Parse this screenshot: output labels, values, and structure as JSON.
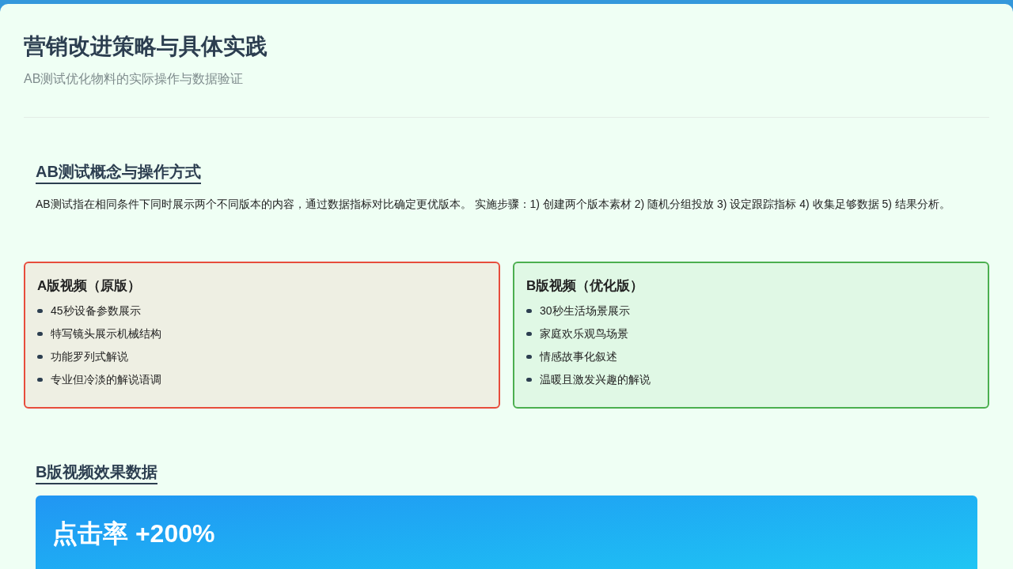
{
  "header": {
    "title": "营销改进策略与具体实践",
    "subtitle": "AB测试优化物料的实际操作与数据验证"
  },
  "concept": {
    "heading": "AB测试概念与操作方式",
    "text": "AB测试指在相同条件下同时展示两个不同版本的内容，通过数据指标对比确定更优版本。 实施步骤：1) 创建两个版本素材 2) 随机分组投放 3) 设定跟踪指标 4) 收集足够数据 5) 结果分析。"
  },
  "versions": [
    {
      "title": "A版视频（原版）",
      "color": "#e74c3c",
      "items": [
        "45秒设备参数展示",
        "特写镜头展示机械结构",
        "功能罗列式解说",
        "专业但冷淡的解说语调"
      ]
    },
    {
      "title": "B版视频（优化版）",
      "color": "#4caf50",
      "items": [
        "30秒生活场景展示",
        "家庭欢乐观鸟场景",
        "情感故事化叙述",
        "温暖且激发兴趣的解说"
      ]
    }
  ],
  "results": {
    "heading": "B版视频效果数据",
    "metric": "点击率 +200%"
  }
}
